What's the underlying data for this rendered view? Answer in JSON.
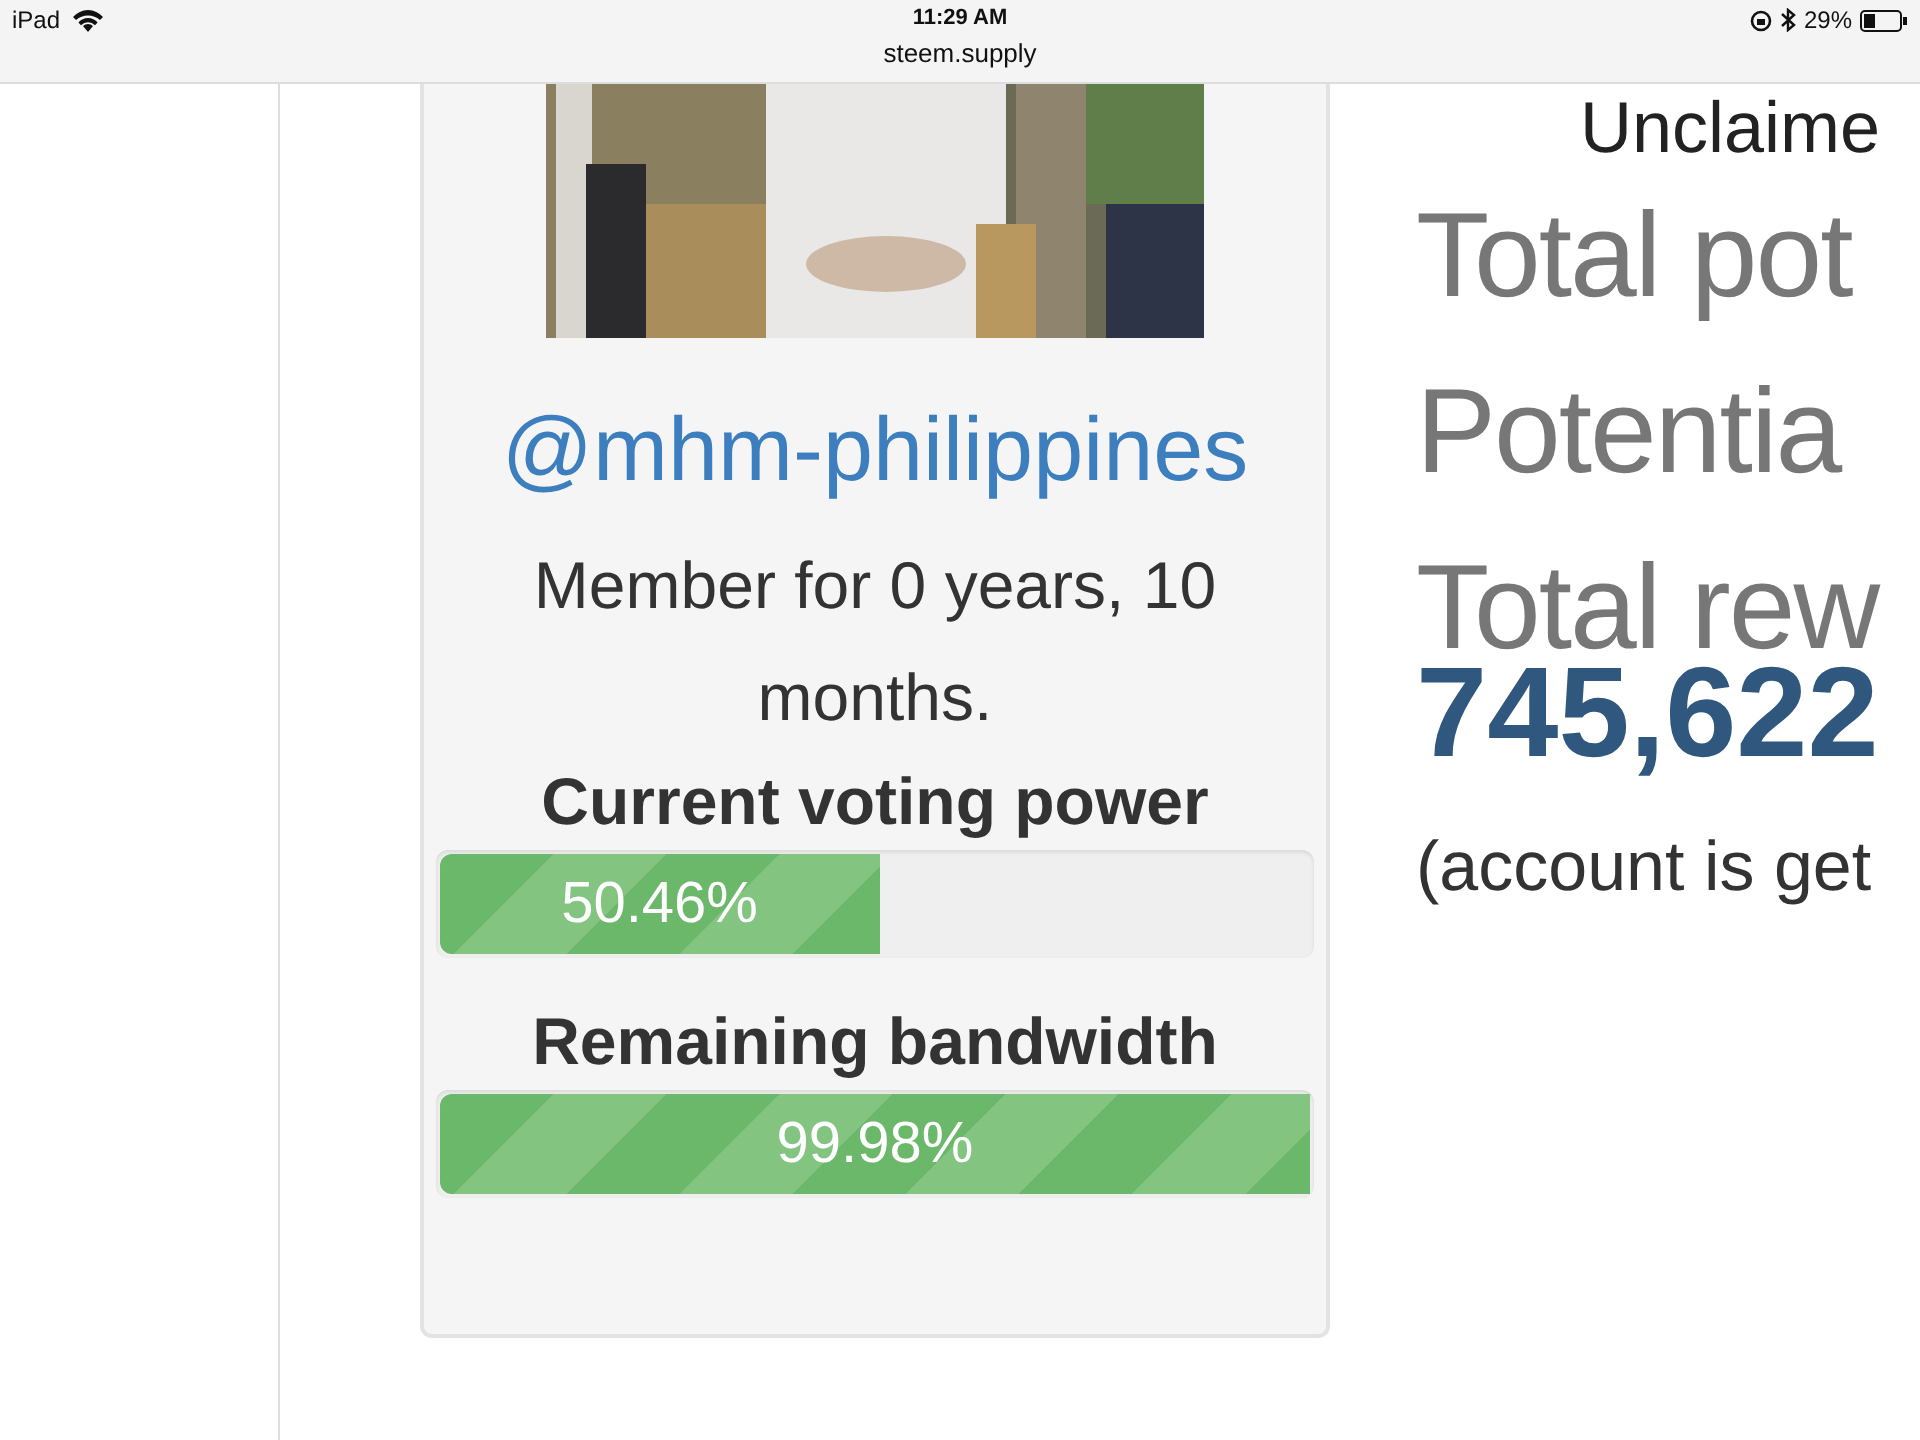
{
  "status_bar": {
    "device": "iPad",
    "time": "11:29 AM",
    "url": "steem.supply",
    "battery": "29%"
  },
  "profile": {
    "username": "@mhm-philippines",
    "member_text": "Member for 0 years, 10 months.",
    "bars": [
      {
        "title": "Current voting power",
        "level": 0.5046,
        "reading": "50.46%"
      },
      {
        "title": "Remaining bandwidth",
        "level": 0.9998,
        "reading": "99.98%"
      }
    ]
  },
  "stats": {
    "top_label": "Unclaime",
    "headings": [
      "Total pot",
      "Potentia",
      "Total rew"
    ],
    "value": "745,622",
    "note": "(account is get"
  }
}
